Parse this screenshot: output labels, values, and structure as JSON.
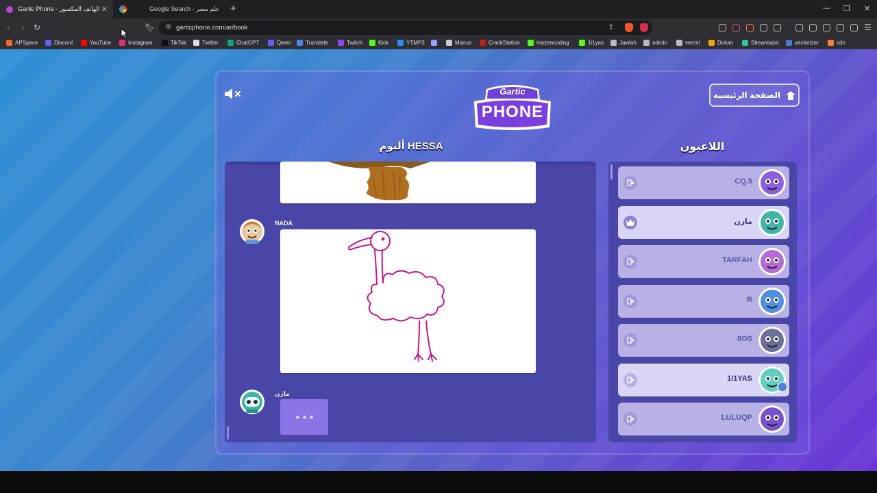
{
  "browser": {
    "active_tab": {
      "title": "Gartic Phone - لعبة الهاتف المكسور"
    },
    "second_tab": {
      "title": "Google Search - علم مصر"
    },
    "url": "garticphone.com/ar/book",
    "bookmarks": [
      {
        "label": "APSpace",
        "color": "#ef6c2c"
      },
      {
        "label": "Discord",
        "color": "#5865f2"
      },
      {
        "label": "YouTube",
        "color": "#ff0000"
      },
      {
        "label": "Instagram",
        "color": "#e1306c"
      },
      {
        "label": "TikTok",
        "color": "#111111"
      },
      {
        "label": "Twitter",
        "color": "#dddddd"
      },
      {
        "label": "ChatGPT",
        "color": "#10a37f"
      },
      {
        "label": "Qwen",
        "color": "#6b5cff"
      },
      {
        "label": "Translate",
        "color": "#4285f4"
      },
      {
        "label": "Twitch",
        "color": "#9146ff"
      },
      {
        "label": "Kick",
        "color": "#53fc18"
      },
      {
        "label": "YTMP3",
        "color": "#2a8cff"
      },
      {
        "label": "",
        "color": "#9aa0ff"
      },
      {
        "label": "Manus",
        "color": "#cccccc"
      },
      {
        "label": "CrackStation",
        "color": "#c21f1f"
      },
      {
        "label": "mazencoding",
        "color": "#53fc18"
      },
      {
        "label": "1i1yas",
        "color": "#53fc18"
      },
      {
        "label": "Jawlah",
        "color": "#bbbbbb"
      },
      {
        "label": "admin",
        "color": "#bbbbbb"
      },
      {
        "label": "vercel",
        "color": "#bbbbbb"
      },
      {
        "label": "Dokan",
        "color": "#f0a500"
      },
      {
        "label": "Streamlabs",
        "color": "#31c3a2"
      },
      {
        "label": "vectorizer",
        "color": "#4a7bd1"
      },
      {
        "label": "cdn",
        "color": "#ff7a3a"
      }
    ]
  },
  "game": {
    "logo_top": "Gartic",
    "logo_bottom": "PHONE",
    "home_button": "الصفحة الرئيسية",
    "album_title": "ألبوم HESSA",
    "players_title": "اللاعبون",
    "album_entries": [
      {
        "author": "NADA",
        "type": "drawing",
        "subject": "ostrich"
      },
      {
        "author": "مازن",
        "type": "typing"
      }
    ],
    "players": [
      {
        "name": "CQ.5",
        "avatar_color": "#8c5fe0",
        "host": false,
        "highlighted": false
      },
      {
        "name": "مازن",
        "avatar_color": "#3fb6a8",
        "host": true,
        "highlighted": true
      },
      {
        "name": "TARFAH",
        "avatar_color": "#b56ad6",
        "host": false,
        "highlighted": false
      },
      {
        "name": "R",
        "avatar_color": "#4d8fe0",
        "host": false,
        "highlighted": false
      },
      {
        "name": "8OS",
        "avatar_color": "#6b6f9a",
        "host": false,
        "highlighted": false
      },
      {
        "name": "1I1YAS",
        "avatar_color": "#5fcfc0",
        "host": false,
        "highlighted": true
      },
      {
        "name": "LULUQP",
        "avatar_color": "#7a4fd0",
        "host": false,
        "highlighted": false
      }
    ]
  }
}
